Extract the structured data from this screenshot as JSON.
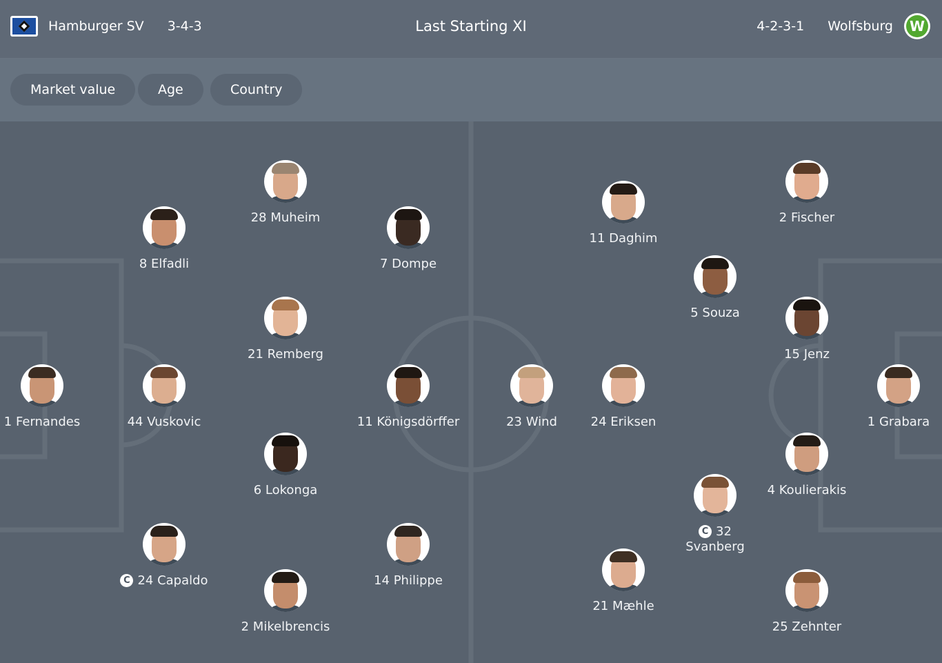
{
  "header": {
    "home": {
      "name": "Hamburger SV",
      "formation": "3-4-3",
      "crest": "hsv-diamond-icon"
    },
    "title": "Last Starting XI",
    "away": {
      "name": "Wolfsburg",
      "formation": "4-2-3-1",
      "crest": "vfl-w-icon"
    }
  },
  "filters": [
    "Market value",
    "Age",
    "Country"
  ],
  "home_players": [
    {
      "number": "28",
      "name": "Muheim",
      "label": "28 Muheim",
      "captain": false
    },
    {
      "number": "8",
      "name": "Elfadli",
      "label": "8 Elfadli",
      "captain": false
    },
    {
      "number": "7",
      "name": "Dompe",
      "label": "7 Dompe",
      "captain": false
    },
    {
      "number": "21",
      "name": "Remberg",
      "label": "21 Remberg",
      "captain": false
    },
    {
      "number": "1",
      "name": "Fernandes",
      "label": "1 Fernandes",
      "captain": false
    },
    {
      "number": "44",
      "name": "Vuskovic",
      "label": "44 Vuskovic",
      "captain": false
    },
    {
      "number": "11",
      "name": "Königsdörffer",
      "label": "11 Königsdörffer",
      "captain": false
    },
    {
      "number": "6",
      "name": "Lokonga",
      "label": "6 Lokonga",
      "captain": false
    },
    {
      "number": "24",
      "name": "Capaldo",
      "label": "24 Capaldo",
      "captain": true
    },
    {
      "number": "14",
      "name": "Philippe",
      "label": "14 Philippe",
      "captain": false
    },
    {
      "number": "2",
      "name": "Mikelbrencis",
      "label": "2 Mikelbrencis",
      "captain": false
    }
  ],
  "away_players": [
    {
      "number": "11",
      "name": "Daghim",
      "label": "11 Daghim",
      "captain": false
    },
    {
      "number": "2",
      "name": "Fischer",
      "label": "2 Fischer",
      "captain": false
    },
    {
      "number": "5",
      "name": "Souza",
      "label": "5 Souza",
      "captain": false
    },
    {
      "number": "15",
      "name": "Jenz",
      "label": "15 Jenz",
      "captain": false
    },
    {
      "number": "23",
      "name": "Wind",
      "label": "23 Wind",
      "captain": false
    },
    {
      "number": "24",
      "name": "Eriksen",
      "label": "24 Eriksen",
      "captain": false
    },
    {
      "number": "1",
      "name": "Grabara",
      "label": "1 Grabara",
      "captain": false
    },
    {
      "number": "4",
      "name": "Koulierakis",
      "label": "4 Koulierakis",
      "captain": false
    },
    {
      "number": "32",
      "name": "Svanberg",
      "label": "32 Svanberg",
      "captain": true
    },
    {
      "number": "21",
      "name": "Mæhle",
      "label": "21 Mæhle",
      "captain": false
    },
    {
      "number": "25",
      "name": "Zehnter",
      "label": "25 Zehnter",
      "captain": false
    }
  ],
  "captain_mark": "C"
}
